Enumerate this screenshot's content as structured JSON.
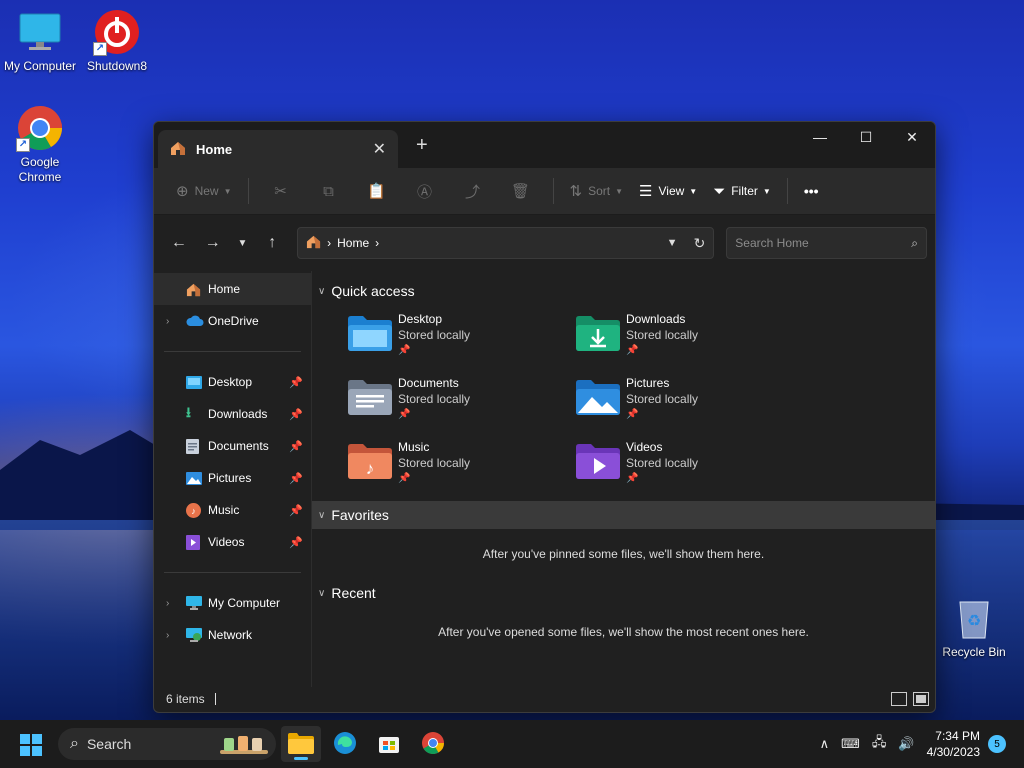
{
  "desktop": {
    "icons": [
      {
        "label": "My Computer"
      },
      {
        "label": "Shutdown8"
      },
      {
        "label": "Google Chrome"
      },
      {
        "label": "Recycle Bin"
      }
    ]
  },
  "window": {
    "tab_title": "Home",
    "toolbar": {
      "new_label": "New",
      "sort_label": "Sort",
      "view_label": "View",
      "filter_label": "Filter",
      "more_label": "•••"
    },
    "address": {
      "location": "Home"
    },
    "search": {
      "placeholder": "Search Home"
    },
    "sidebar": {
      "top": [
        {
          "label": "Home"
        },
        {
          "label": "OneDrive"
        }
      ],
      "pinned": [
        {
          "label": "Desktop"
        },
        {
          "label": "Downloads"
        },
        {
          "label": "Documents"
        },
        {
          "label": "Pictures"
        },
        {
          "label": "Music"
        },
        {
          "label": "Videos"
        }
      ],
      "bottom": [
        {
          "label": "My Computer"
        },
        {
          "label": "Network"
        }
      ]
    },
    "sections": {
      "quick_access": "Quick access",
      "favorites": "Favorites",
      "favorites_empty": "After you've pinned some files, we'll show them here.",
      "recent": "Recent",
      "recent_empty": "After you've opened some files, we'll show the most recent ones here."
    },
    "quick_access_items": [
      {
        "name": "Desktop",
        "status": "Stored locally",
        "color": "#3aa0e8"
      },
      {
        "name": "Downloads",
        "status": "Stored locally",
        "color": "#1fb380"
      },
      {
        "name": "Documents",
        "status": "Stored locally",
        "color": "#8a96a8"
      },
      {
        "name": "Pictures",
        "status": "Stored locally",
        "color": "#2f8ee0"
      },
      {
        "name": "Music",
        "status": "Stored locally",
        "color": "#e8734a"
      },
      {
        "name": "Videos",
        "status": "Stored locally",
        "color": "#8a4fd8"
      }
    ],
    "status": {
      "item_count": "6 items"
    }
  },
  "taskbar": {
    "search_label": "Search",
    "time": "7:34 PM",
    "date": "4/30/2023",
    "notification_count": "5"
  },
  "colors": {
    "accent": "#4cc2ff",
    "window_bg": "#202020",
    "toolbar_bg": "#2b2b2b"
  }
}
